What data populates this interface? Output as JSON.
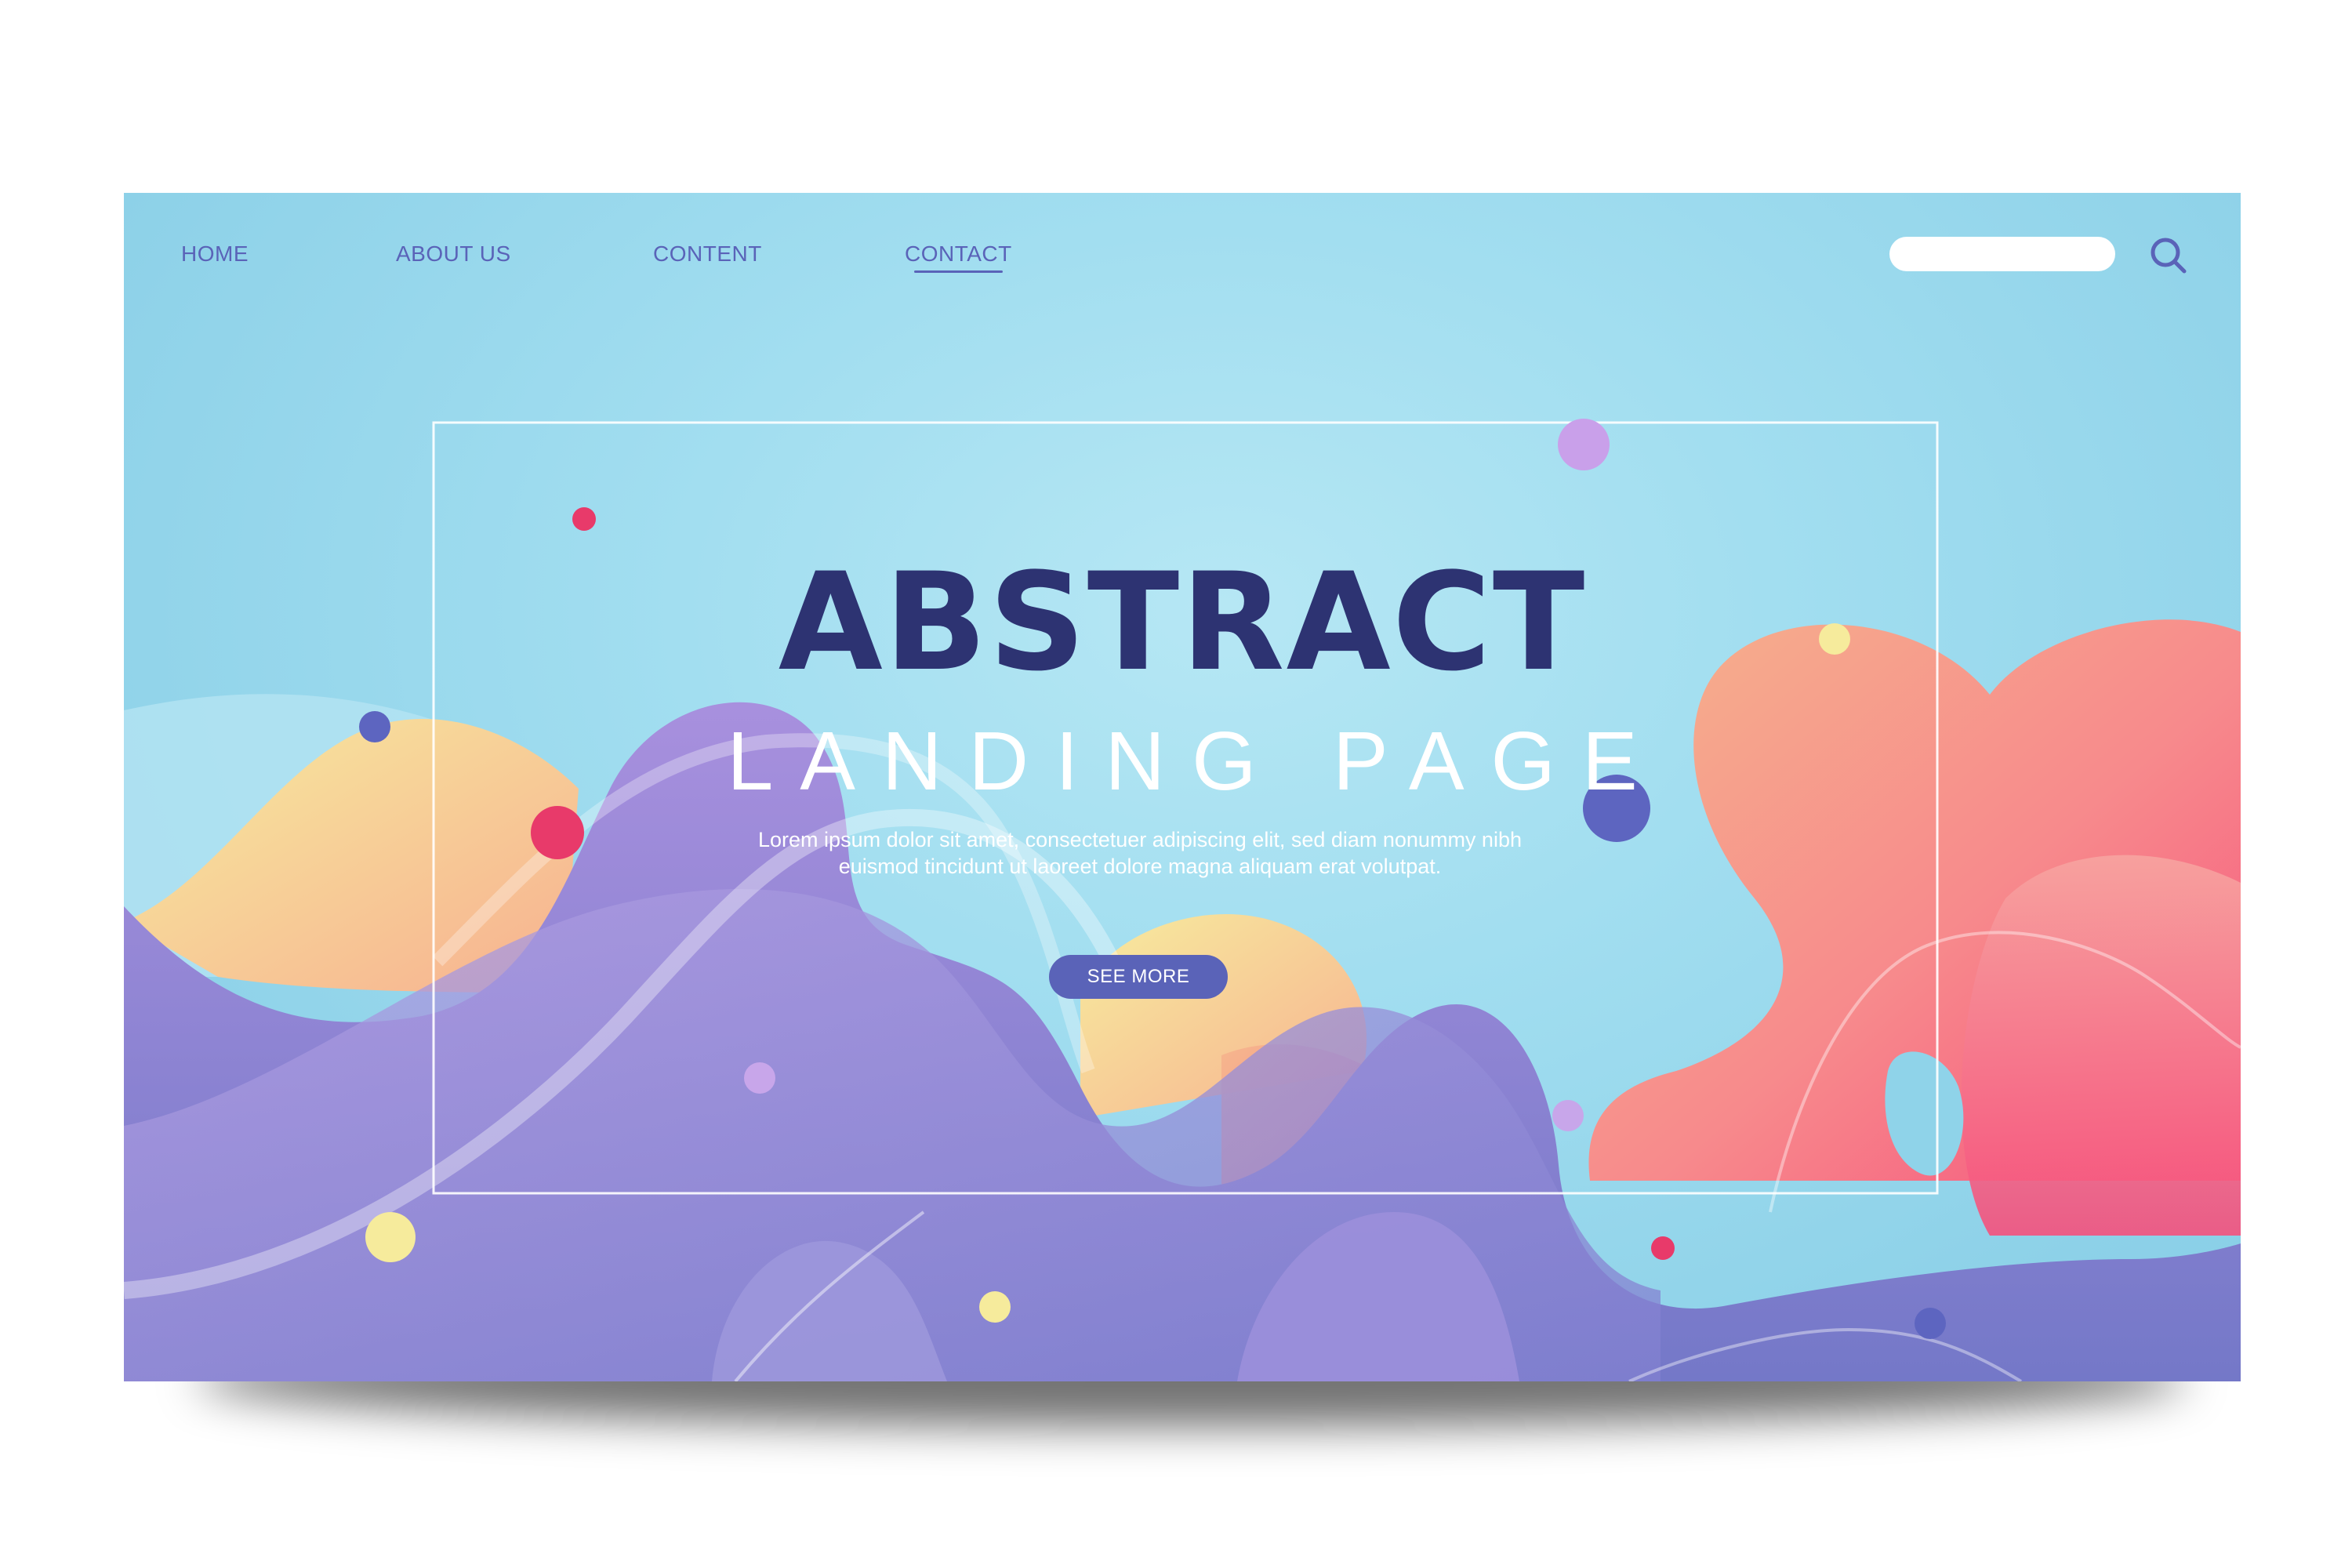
{
  "nav": {
    "items": [
      {
        "label": "HOME",
        "active": false
      },
      {
        "label": "ABOUT US",
        "active": false
      },
      {
        "label": "CONTENT",
        "active": false
      },
      {
        "label": "CONTACT",
        "active": true
      }
    ],
    "search": {
      "value": "",
      "placeholder": ""
    },
    "search_icon": "search-icon"
  },
  "hero": {
    "title": "ABSTRACT",
    "subtitle": "LANDING PAGE",
    "body_line1": "Lorem ipsum dolor sit amet, consectetuer adipiscing elit, sed diam nonummy nibh",
    "body_line2": "euismod tincidunt ut laoreet dolore magna aliquam erat volutpat.",
    "cta_label": "SEE MORE"
  },
  "colors": {
    "sky": "#9ddbee",
    "navy": "#2d3372",
    "accent": "#5a63b8",
    "purple": "#8a84d4",
    "coral": "#f7898a",
    "pink": "#f5607f",
    "yellow": "#f5e79a"
  }
}
